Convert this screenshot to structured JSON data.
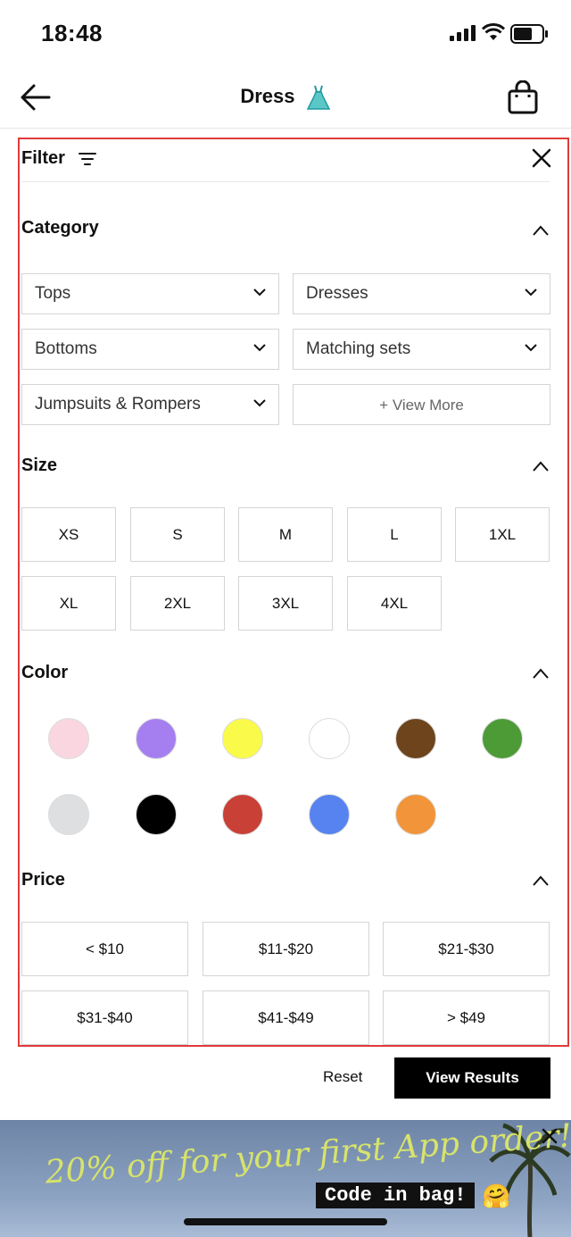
{
  "status_bar": {
    "time": "18:48"
  },
  "header": {
    "title": "Dress",
    "title_emoji": "dress-icon"
  },
  "filter": {
    "label": "Filter",
    "category": {
      "title": "Category",
      "items": [
        "Tops",
        "Dresses",
        "Bottoms",
        "Matching sets",
        "Jumpsuits & Rompers"
      ],
      "view_more": "+ View More"
    },
    "size": {
      "title": "Size",
      "options": [
        "XS",
        "S",
        "M",
        "L",
        "1XL",
        "XL",
        "2XL",
        "3XL",
        "4XL"
      ]
    },
    "color": {
      "title": "Color",
      "swatches": [
        "#f9d6e0",
        "#a57ff0",
        "#fafa4a",
        "#ffffff",
        "#6e441c",
        "#4c9b37",
        "#dedfe1",
        "#000000",
        "#c94036",
        "#5683f0",
        "#f1943a"
      ]
    },
    "price": {
      "title": "Price",
      "options": [
        "< $10",
        "$11-$20",
        "$21-$30",
        "$31-$40",
        "$41-$49",
        "> $49"
      ]
    }
  },
  "actions": {
    "reset": "Reset",
    "view_results": "View Results"
  },
  "banner": {
    "promo": "20% off for your first App order!",
    "code": "Code in bag!",
    "emoji": "🤗"
  },
  "colors": {
    "accent_outline": "#e03a3a",
    "primary_button": "#000000"
  }
}
